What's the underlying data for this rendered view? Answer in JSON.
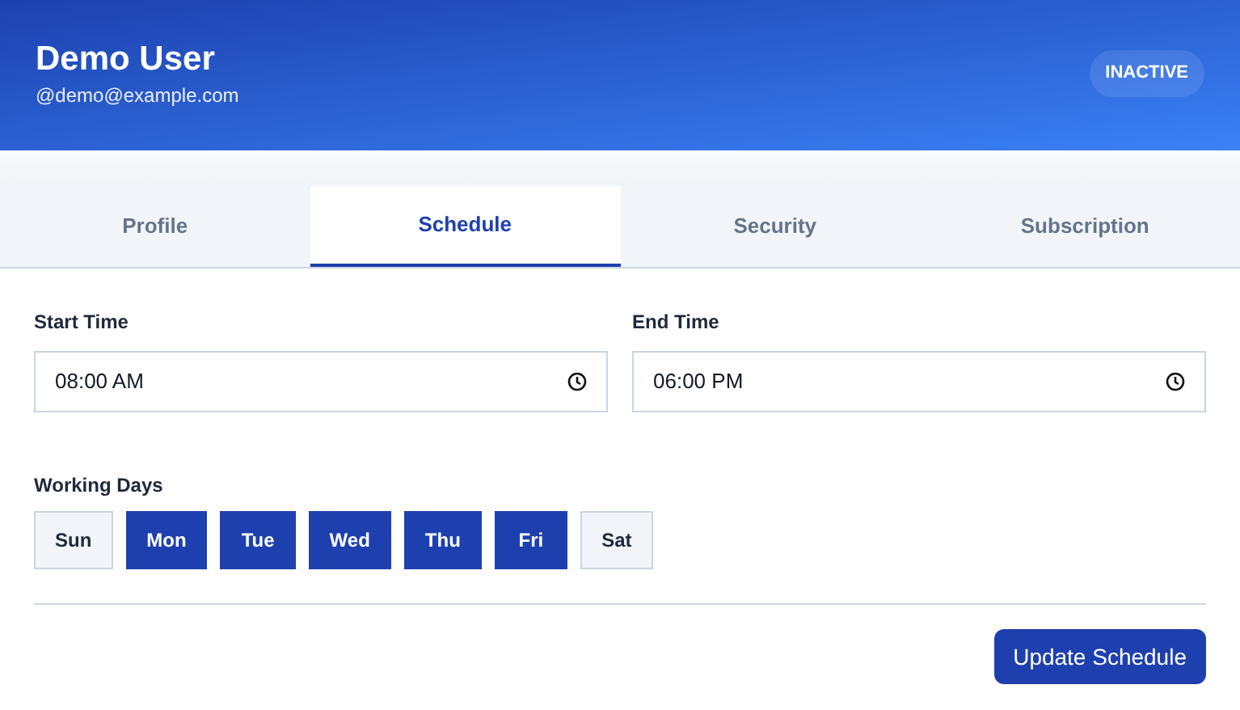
{
  "profile": {
    "name": "Demo User",
    "handle": "@demo@example.com",
    "status": "INACTIVE"
  },
  "tabs": [
    {
      "label": "Profile",
      "selected": false
    },
    {
      "label": "Schedule",
      "selected": true
    },
    {
      "label": "Security",
      "selected": false
    },
    {
      "label": "Subscription",
      "selected": false
    }
  ],
  "fields": [
    {
      "label": "Start Time",
      "value": "08:00 AM"
    },
    {
      "label": "End Time",
      "value": "06:00 PM"
    }
  ],
  "working_days": {
    "label": "Working Days",
    "days": [
      {
        "label": "Sun",
        "selected": false
      },
      {
        "label": "Mon",
        "selected": true
      },
      {
        "label": "Tue",
        "selected": true
      },
      {
        "label": "Wed",
        "selected": true
      },
      {
        "label": "Thu",
        "selected": true
      },
      {
        "label": "Fri",
        "selected": true
      },
      {
        "label": "Sat",
        "selected": false
      }
    ]
  },
  "submit_button": "Update Schedule"
}
